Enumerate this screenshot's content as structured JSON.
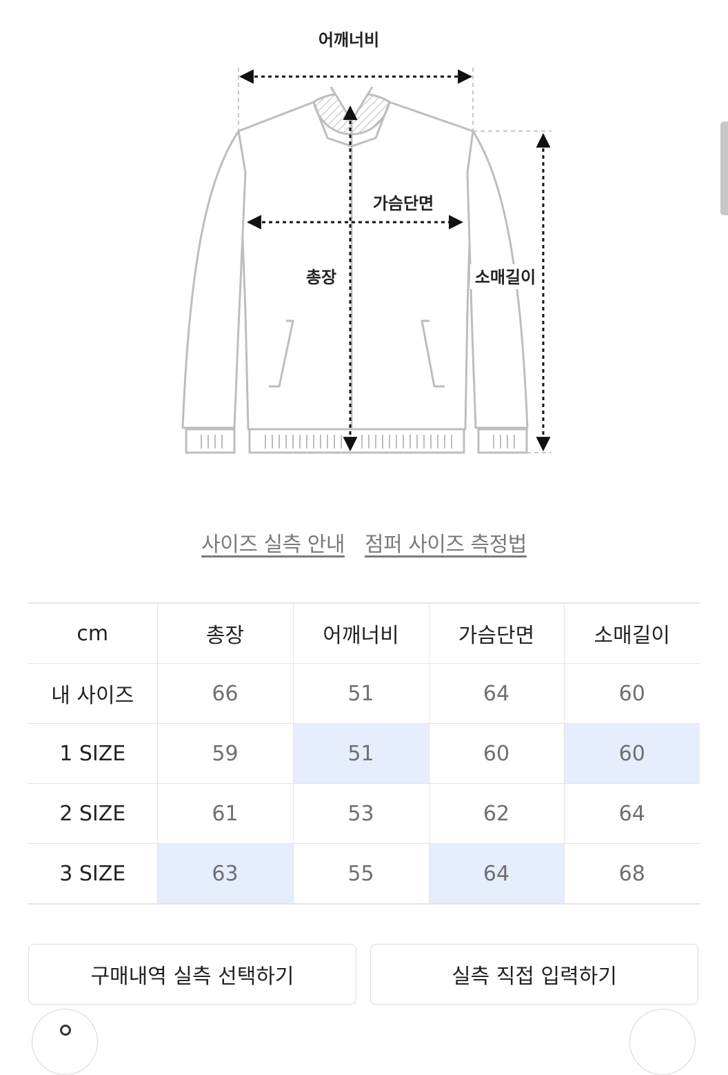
{
  "diagram": {
    "labels": {
      "shoulder": "어깨너비",
      "chest": "가슴단면",
      "length": "총장",
      "sleeve": "소매길이"
    }
  },
  "links": {
    "size_guide": "사이즈 실측 안내",
    "measure_method": "점퍼 사이즈 측정법"
  },
  "table": {
    "unit": "cm",
    "columns": [
      "총장",
      "어깨너비",
      "가슴단면",
      "소매길이"
    ],
    "rows": [
      {
        "label": "내 사이즈",
        "values": [
          "66",
          "51",
          "64",
          "60"
        ],
        "highlight": [
          false,
          false,
          false,
          false
        ]
      },
      {
        "label": "1 SIZE",
        "values": [
          "59",
          "51",
          "60",
          "60"
        ],
        "highlight": [
          false,
          true,
          false,
          true
        ]
      },
      {
        "label": "2 SIZE",
        "values": [
          "61",
          "53",
          "62",
          "64"
        ],
        "highlight": [
          false,
          false,
          false,
          false
        ]
      },
      {
        "label": "3 SIZE",
        "values": [
          "63",
          "55",
          "64",
          "68"
        ],
        "highlight": [
          true,
          false,
          true,
          false
        ]
      }
    ],
    "highlight_color": "#e6edfc"
  },
  "buttons": {
    "history": "구매내역 실측 선택하기",
    "direct_input": "실측 직접 입력하기"
  }
}
